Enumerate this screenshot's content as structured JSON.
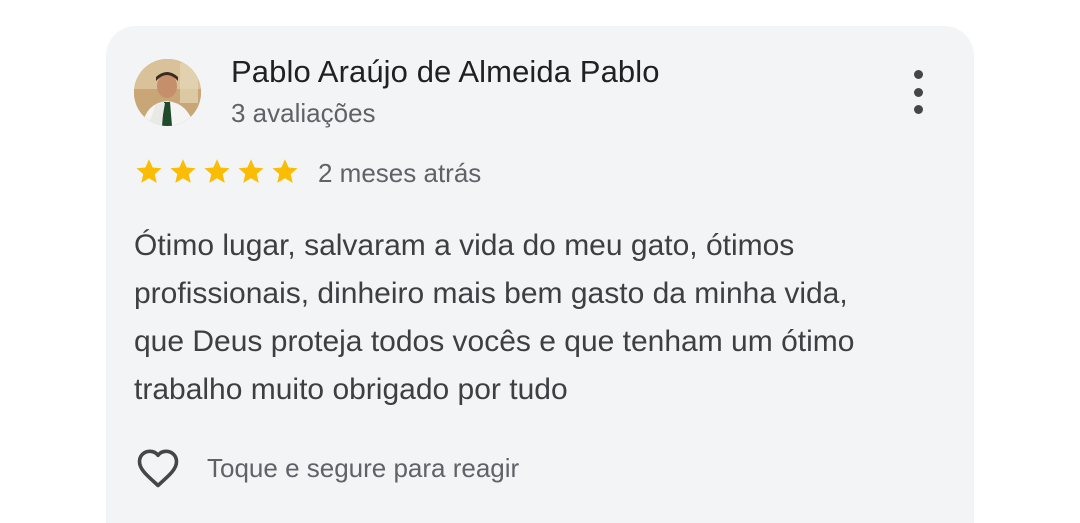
{
  "review": {
    "author_name": "Pablo Araújo de Almeida Pablo",
    "author_reviews": "3 avaliações",
    "rating": 5,
    "rating_max": 5,
    "time_ago": "2 meses atrás",
    "text": "Ótimo lugar, salvaram a vida do meu gato, ótimos\nprofissionais, dinheiro mais bem gasto da minha vida,\nque Deus proteja todos vocês e que tenham um ótimo\ntrabalho muito obrigado por tudo",
    "react_label": "Toque e segure para reagir"
  },
  "icons": {
    "more": "more-vert-icon",
    "star": "star-icon",
    "react": "heart-outline-icon"
  },
  "colors": {
    "card_background": "#f3f4f6",
    "star": "#fbbc04",
    "primary_text": "#202124",
    "secondary_text": "#5f6368"
  }
}
